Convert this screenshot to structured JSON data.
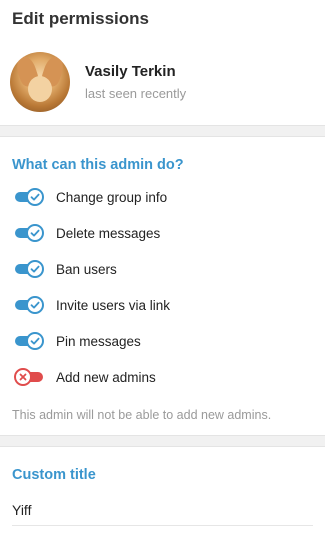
{
  "header": {
    "title": "Edit permissions"
  },
  "user": {
    "name": "Vasily Terkin",
    "status": "last seen recently"
  },
  "permissions": {
    "section_title": "What can this admin do?",
    "items": [
      {
        "label": "Change group info",
        "enabled": true
      },
      {
        "label": "Delete messages",
        "enabled": true
      },
      {
        "label": "Ban users",
        "enabled": true
      },
      {
        "label": "Invite users via link",
        "enabled": true
      },
      {
        "label": "Pin messages",
        "enabled": true
      },
      {
        "label": "Add new admins",
        "enabled": false
      }
    ],
    "note": "This admin will not be able to add new admins."
  },
  "custom_title": {
    "section_title": "Custom title",
    "value": "Yiff"
  },
  "colors": {
    "accent": "#3a95cd",
    "danger": "#e04c4c"
  }
}
